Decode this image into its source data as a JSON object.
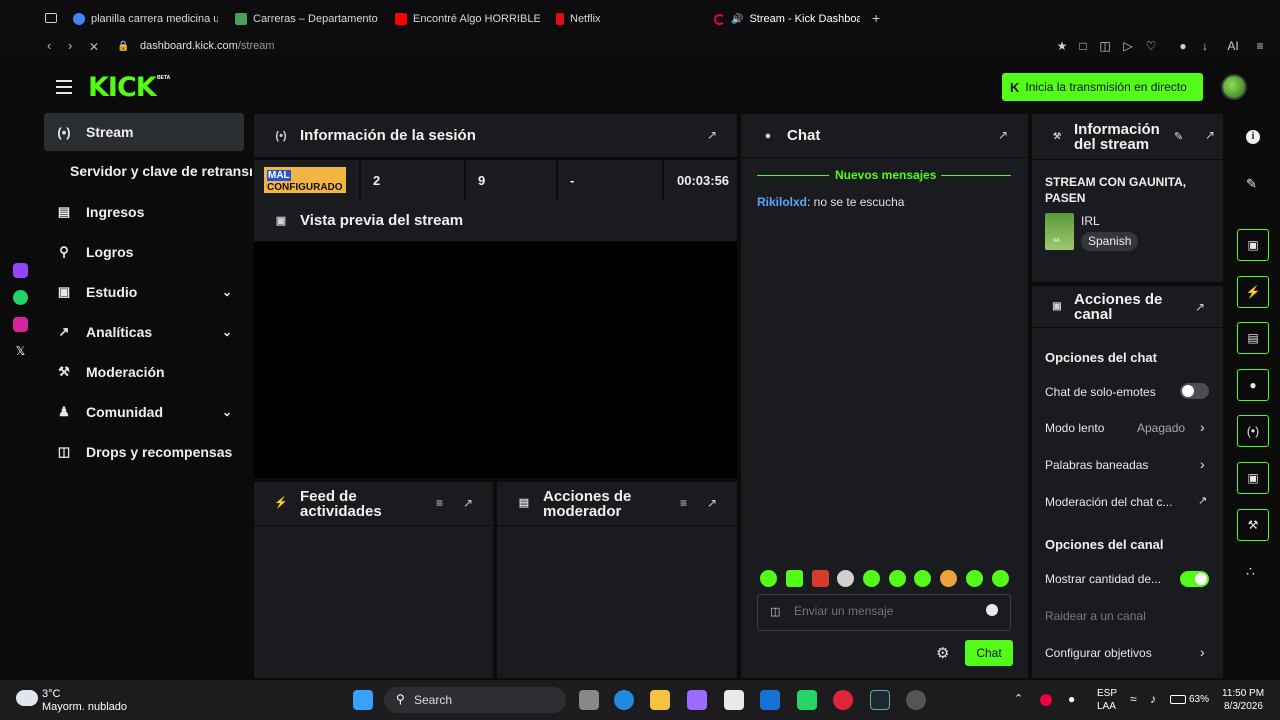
{
  "browser": {
    "tabs": [
      {
        "label": "planilla carrera medicina ut",
        "color": "#4285f4"
      },
      {
        "label": "Carreras – Departamento d",
        "color": "#4aa05a"
      },
      {
        "label": "Encontré Algo HORRIBLE e",
        "color": "#ff0000"
      },
      {
        "label": "Netflix",
        "color": "#e50914"
      },
      {
        "label": "Stream - Kick Dashboar",
        "color": "#53fc18"
      }
    ],
    "new_tab": "+",
    "url_host": "dashboard.kick.com",
    "url_path": "/stream",
    "ai_label": "AI"
  },
  "header": {
    "logo": "KICK",
    "beta": "BETA",
    "go_live": "Inicia la transmisión en directo"
  },
  "sidebar": {
    "items": [
      {
        "label": "Stream",
        "icon": "broadcast-icon"
      },
      {
        "label": "Servidor y clave de retransmisión"
      },
      {
        "label": "Ingresos",
        "icon": "chart-icon"
      },
      {
        "label": "Logros",
        "icon": "trophy-icon"
      },
      {
        "label": "Estudio",
        "icon": "studio-icon"
      },
      {
        "label": "Analíticas",
        "icon": "analytics-icon"
      },
      {
        "label": "Moderación",
        "icon": "wrench-icon"
      },
      {
        "label": "Comunidad",
        "icon": "community-icon"
      },
      {
        "label": "Drops y recompensas",
        "icon": "gift-icon"
      }
    ]
  },
  "session": {
    "title": "Información de la sesión",
    "badge_top": "MAL",
    "badge_bottom": "CONFIGURADO",
    "values": [
      "2",
      "9",
      "-",
      "00:03:56"
    ]
  },
  "preview": {
    "title": "Vista previa del stream"
  },
  "feed": {
    "title_1": "Feed de",
    "title_2": "actividades"
  },
  "mod_actions": {
    "title_1": "Acciones de",
    "title_2": "moderador"
  },
  "chat": {
    "title": "Chat",
    "new_messages": "Nuevos mensajes",
    "messages": [
      {
        "user": "Rikilolxd",
        "text": ": no se te escucha"
      }
    ],
    "placeholder": "Enviar un mensaje",
    "send": "Chat"
  },
  "stream_info": {
    "title_1": "Información",
    "title_2": "del stream",
    "stream_title_1": "STREAM CON GAUNITA,",
    "stream_title_2": "PASEN",
    "category": "IRL",
    "language": "Spanish",
    "thumb_text": "IRL"
  },
  "channel_actions": {
    "title_1": "Acciones de",
    "title_2": "canal",
    "chat_options": "Opciones del chat",
    "emote_only": "Chat de solo-emotes",
    "emote_only_on": false,
    "slow_mode": "Modo lento",
    "slow_mode_value": "Apagado",
    "banned_words": "Palabras baneadas",
    "chat_moderation": "Moderación del chat c...",
    "channel_options": "Opciones del canal",
    "show_viewers": "Mostrar cantidad de...",
    "show_viewers_on": true,
    "raid": "Raidear a un canal",
    "goals": "Configurar objetivos"
  },
  "taskbar": {
    "temp": "3°C",
    "weather": "Mayorm. nublado",
    "search": "Search",
    "lang_1": "ESP",
    "lang_2": "LAA",
    "battery": "63%",
    "time": "11:50 PM",
    "date": "8/3/2026"
  },
  "colors": {
    "accent": "#53fc18",
    "panel": "#191b1f",
    "bg": "#0b0b0c"
  }
}
